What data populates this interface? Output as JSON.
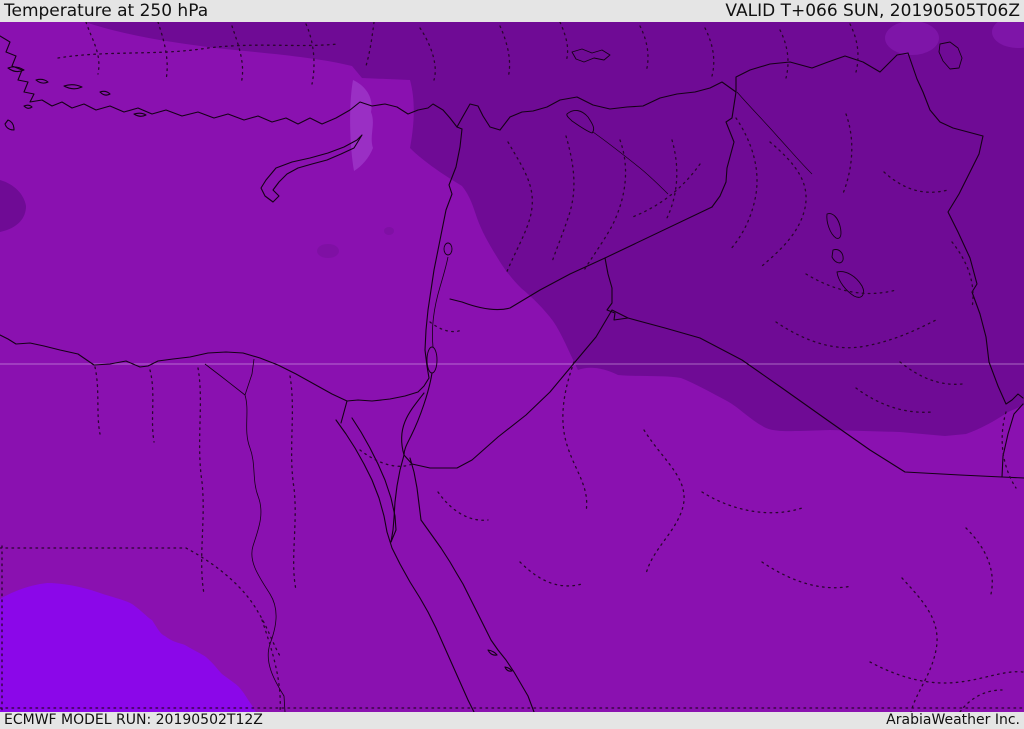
{
  "header": {
    "title": "Temperature at 250 hPa",
    "valid_label": "VALID T+066 SUN, 20190505T06Z"
  },
  "footer": {
    "model_run": "ECMWF MODEL RUN: 20190502T12Z",
    "brand": "ArabiaWeather Inc."
  },
  "map": {
    "kind": "temperature shading map, Middle East / Eastern Mediterranean",
    "colors": {
      "bar_background": "#e5e5e5",
      "bar_text": "#111111",
      "shade_warm_bright_southwest": "#8b07e9",
      "shade_base": "#8a11b0",
      "shade_cold_northeast": "#6f0b95",
      "shade_cold_pocket": "#7e15a8",
      "shade_light_patch": "#9a2fc4",
      "coast_border_line": "#150016",
      "admin_dotted_line": "#2a052e",
      "latitude_gridline": "#e2c6ee"
    }
  }
}
